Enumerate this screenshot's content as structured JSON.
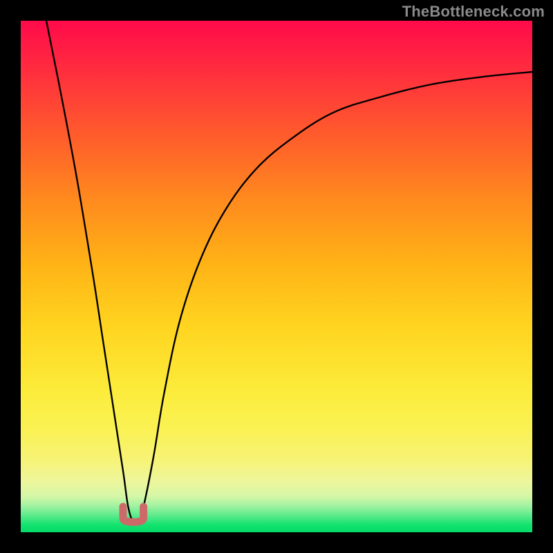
{
  "watermark": "TheBottleneck.com",
  "chart_data": {
    "type": "line",
    "title": "",
    "xlabel": "",
    "ylabel": "",
    "xlim": [
      0,
      100
    ],
    "ylim": [
      0,
      100
    ],
    "grid": false,
    "legend": false,
    "annotations": [],
    "background": {
      "type": "vertical-gradient",
      "meaning": "bottleneck severity scale (red high, green low)",
      "stops": [
        {
          "pos": 0,
          "color": "#ff0a4a"
        },
        {
          "pos": 22,
          "color": "#ff5a2c"
        },
        {
          "pos": 48,
          "color": "#ffb416"
        },
        {
          "pos": 72,
          "color": "#fceb3a"
        },
        {
          "pos": 90,
          "color": "#eef69c"
        },
        {
          "pos": 97,
          "color": "#52e988"
        },
        {
          "pos": 100,
          "color": "#04db68"
        }
      ]
    },
    "series": [
      {
        "name": "bottleneck-curve",
        "color": "#000000",
        "x": [
          5,
          8,
          11,
          14,
          16,
          18,
          20,
          21,
          22,
          23,
          24,
          26,
          28,
          31,
          35,
          40,
          46,
          53,
          61,
          70,
          80,
          90,
          100
        ],
        "y": [
          100,
          85,
          69,
          51,
          38,
          25,
          12,
          5,
          2,
          2,
          5,
          15,
          27,
          41,
          53,
          63,
          71,
          77,
          82,
          85,
          87.5,
          89,
          90
        ]
      }
    ],
    "marker": {
      "name": "optimal-range",
      "color": "#cc6a6a",
      "shape": "U",
      "x_range": [
        20,
        24
      ],
      "y": 2
    }
  }
}
